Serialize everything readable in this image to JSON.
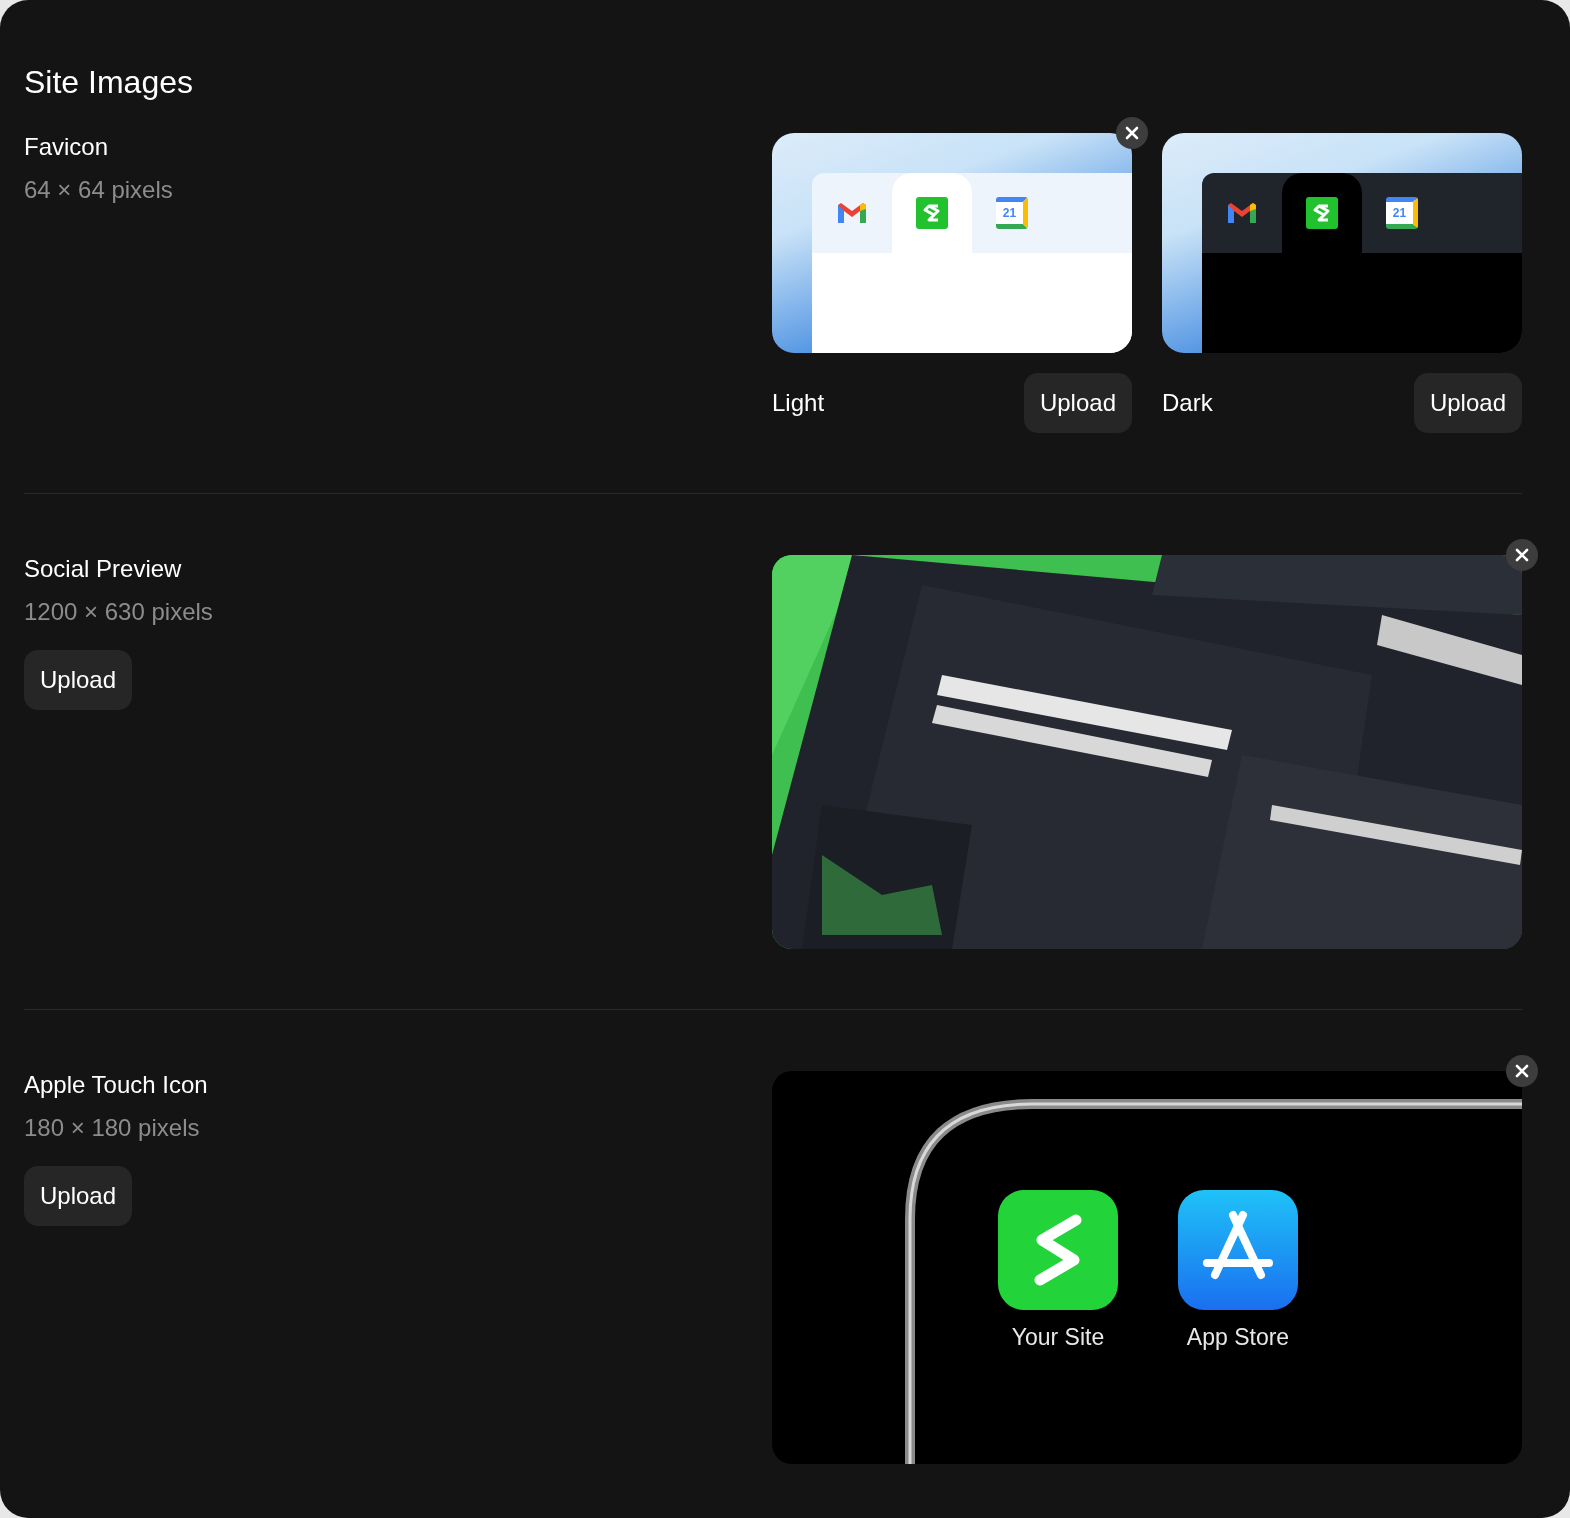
{
  "title": "Site Images",
  "sections": [
    {
      "kind": "favicon",
      "label": "Favicon",
      "size": "64 × 64 pixels",
      "variants": [
        {
          "kind": "light",
          "label": "Light",
          "upload": "Upload",
          "removable": true,
          "calendar_day": "21"
        },
        {
          "kind": "dark",
          "label": "Dark",
          "upload": "Upload",
          "removable": false,
          "calendar_day": "21"
        }
      ]
    },
    {
      "kind": "social",
      "label": "Social Preview",
      "size": "1200 × 630 pixels",
      "upload": "Upload",
      "removable": true
    },
    {
      "kind": "touch_icon",
      "label": "Apple Touch Icon",
      "size": "180 × 180 pixels",
      "upload": "Upload",
      "removable": true,
      "apps": [
        {
          "kind": "site",
          "label": "Your Site"
        },
        {
          "kind": "store",
          "label": "App Store"
        }
      ]
    }
  ]
}
